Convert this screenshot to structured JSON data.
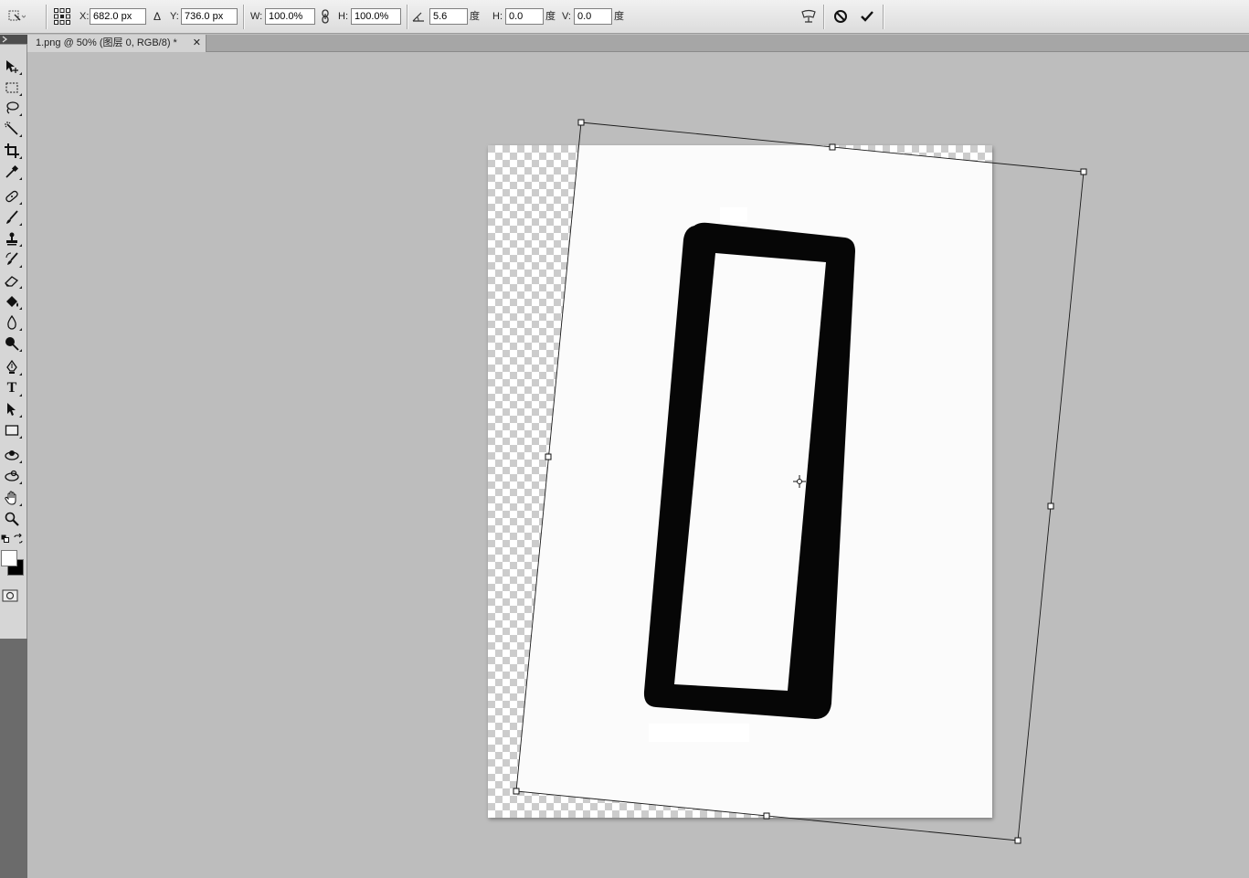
{
  "options_bar": {
    "x_label": "X:",
    "x_value": "682.0 px",
    "delta_icon": "delta-triangle-icon",
    "y_label": "Y:",
    "y_value": "736.0 px",
    "w_label": "W:",
    "w_value": "100.0%",
    "h_label": "H:",
    "h_value": "100.0%",
    "rotate_value": "5.6",
    "rotate_unit": "度",
    "hskew_label": "H:",
    "hskew_value": "0.0",
    "hskew_unit": "度",
    "vskew_label": "V:",
    "vskew_value": "0.0",
    "vskew_unit": "度"
  },
  "document": {
    "tab_title": "1.png @ 50% (图层 0, RGB/8) *",
    "close_glyph": "✕"
  },
  "tools": [
    "move-tool-icon",
    "marquee-tool-icon",
    "lasso-tool-icon",
    "magic-wand-tool-icon",
    "crop-tool-icon",
    "eyedropper-tool-icon",
    "spot-healing-tool-icon",
    "brush-tool-icon",
    "clone-stamp-tool-icon",
    "history-brush-tool-icon",
    "eraser-tool-icon",
    "paint-bucket-tool-icon",
    "blur-tool-icon",
    "dodge-tool-icon",
    "pen-tool-icon",
    "type-tool-icon",
    "path-selection-tool-icon",
    "rectangle-tool-icon",
    "3d-rotate-tool-icon",
    "3d-orbit-tool-icon",
    "hand-tool-icon",
    "zoom-tool-icon"
  ],
  "tool_glyphs": {
    "type": "T"
  },
  "colors": {
    "foreground": "#ffffff",
    "background": "#000000",
    "canvas_bg": "#bdbdbd"
  }
}
